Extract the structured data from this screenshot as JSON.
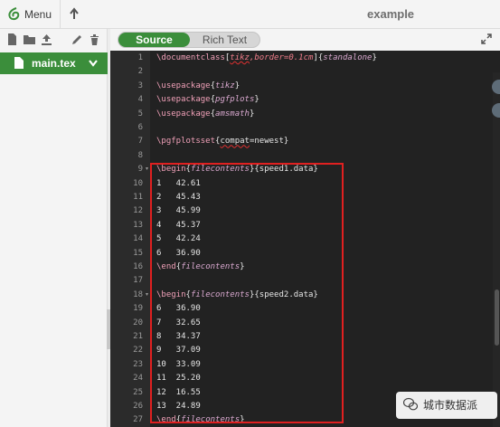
{
  "header": {
    "menu_label": "Menu",
    "project_title": "example",
    "icons": {
      "logo": "overleaf-leaf-icon",
      "up": "upload-arrow-icon"
    }
  },
  "sidebar": {
    "toolbar_icons": [
      "new-file-icon",
      "new-folder-icon",
      "upload-icon",
      "rename-pencil-icon",
      "delete-trash-icon"
    ],
    "active_file": "main.tex"
  },
  "editor": {
    "mode_toggle": {
      "source_label": "Source",
      "rich_label": "Rich Text",
      "active": "Source"
    },
    "lines": [
      {
        "n": "1",
        "text": "\\documentclass[tikz,border=0.1cm]{standalone}"
      },
      {
        "n": "2",
        "text": ""
      },
      {
        "n": "3",
        "text": "\\usepackage{tikz}"
      },
      {
        "n": "4",
        "text": "\\usepackage{pgfplots}"
      },
      {
        "n": "5",
        "text": "\\usepackage{amsmath}"
      },
      {
        "n": "6",
        "text": ""
      },
      {
        "n": "7",
        "text": "\\pgfplotsset{compat=newest}"
      },
      {
        "n": "8",
        "text": ""
      },
      {
        "n": "9",
        "text": "\\begin{filecontents}{speed1.data}"
      },
      {
        "n": "10",
        "text": "1   42.61"
      },
      {
        "n": "11",
        "text": "2   45.43"
      },
      {
        "n": "12",
        "text": "3   45.99"
      },
      {
        "n": "13",
        "text": "4   45.37"
      },
      {
        "n": "14",
        "text": "5   42.24"
      },
      {
        "n": "15",
        "text": "6   36.90"
      },
      {
        "n": "16",
        "text": "\\end{filecontents}"
      },
      {
        "n": "17",
        "text": ""
      },
      {
        "n": "18",
        "text": "\\begin{filecontents}{speed2.data}"
      },
      {
        "n": "19",
        "text": "6   36.90"
      },
      {
        "n": "20",
        "text": "7   32.65"
      },
      {
        "n": "21",
        "text": "8   34.37"
      },
      {
        "n": "22",
        "text": "9   37.09"
      },
      {
        "n": "23",
        "text": "10  33.09"
      },
      {
        "n": "24",
        "text": "11  25.20"
      },
      {
        "n": "25",
        "text": "12  16.55"
      },
      {
        "n": "26",
        "text": "13  24.89"
      },
      {
        "n": "27",
        "text": "\\end{filecontents}"
      }
    ],
    "fold_markers": [
      "9",
      "18"
    ],
    "highlight_color": "#e02020"
  },
  "watermark": {
    "text": "城市数据派"
  },
  "colors": {
    "accent": "#3b8e3b",
    "editor_bg": "#222222"
  }
}
